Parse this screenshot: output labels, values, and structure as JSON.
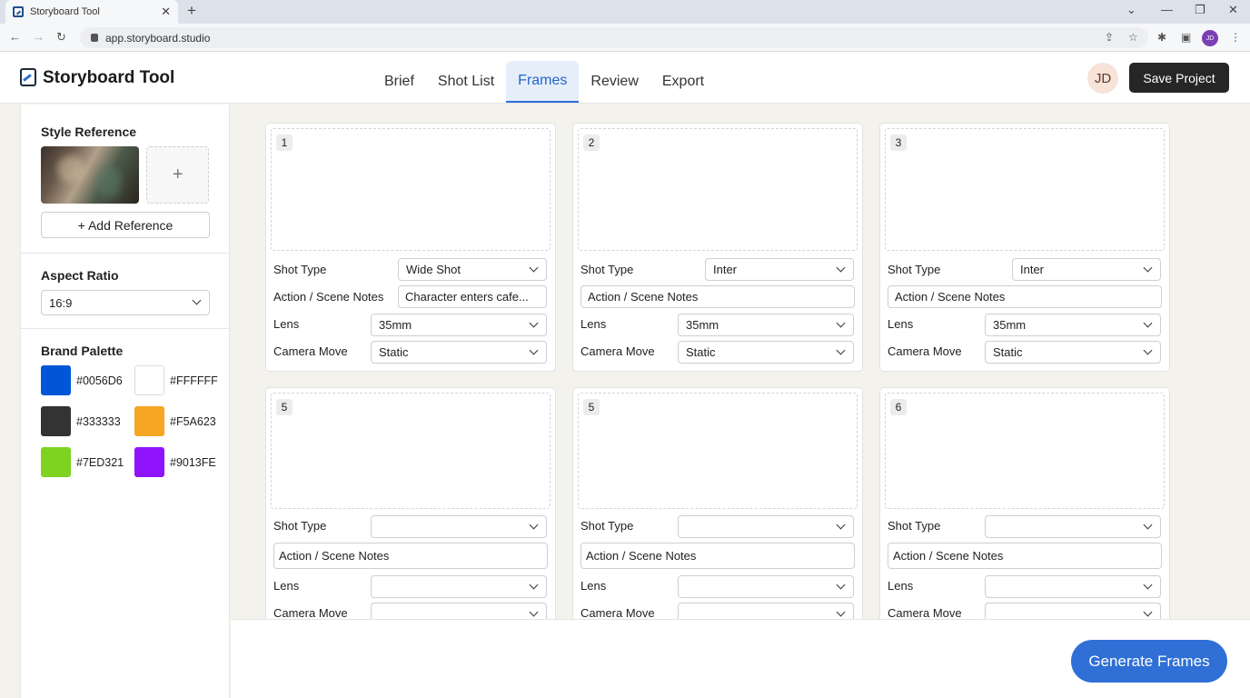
{
  "browser": {
    "tab_title": "Storyboard Tool",
    "tab_close": "✕",
    "new_tab": "+",
    "url": "app.storyboard.studio",
    "profile_initials": "JD"
  },
  "app": {
    "brand": "Storyboard Tool",
    "nav": [
      {
        "label": "Brief",
        "active": false
      },
      {
        "label": "Shot List",
        "active": false
      },
      {
        "label": "Frames",
        "active": true
      },
      {
        "label": "Review",
        "active": false
      },
      {
        "label": "Export",
        "active": false
      }
    ],
    "user_initials": "JD",
    "save_label": "Save Project"
  },
  "sidebar": {
    "style_reference": {
      "title": "Style Reference",
      "add_tile": "+",
      "add_button": "+ Add Reference"
    },
    "aspect_ratio": {
      "title": "Aspect Ratio",
      "value": "16:9"
    },
    "brand_palette": {
      "title": "Brand Palette",
      "colors": [
        {
          "hex": "#0056D6"
        },
        {
          "hex": "#FFFFFF"
        },
        {
          "hex": "#333333"
        },
        {
          "hex": "#F5A623"
        },
        {
          "hex": "#7ED321"
        },
        {
          "hex": "#9013FE"
        }
      ]
    }
  },
  "labels": {
    "shot_type": "Shot Type",
    "notes": "Action / Scene Notes",
    "lens": "Lens",
    "camera_move": "Camera Move"
  },
  "frames": [
    {
      "number": "1",
      "shot_type": "Wide Shot",
      "notes": "Character enters cafe...",
      "lens": "35mm",
      "camera_move": "Static"
    },
    {
      "number": "2",
      "shot_type": "Inter",
      "notes": "Action / Scene Notes",
      "lens": "35mm",
      "camera_move": "Static"
    },
    {
      "number": "3",
      "shot_type": "Inter",
      "notes": "Action / Scene Notes",
      "lens": "35mm",
      "camera_move": "Static"
    },
    {
      "number": "5",
      "shot_type": "",
      "notes": "Action / Scene Notes",
      "lens": "",
      "camera_move": ""
    },
    {
      "number": "5",
      "shot_type": "",
      "notes": "Action / Scene Notes",
      "lens": "",
      "camera_move": ""
    },
    {
      "number": "6",
      "shot_type": "",
      "notes": "Action / Scene Notes",
      "lens": "",
      "camera_move": ""
    }
  ],
  "generate_label": "Generate Frames"
}
